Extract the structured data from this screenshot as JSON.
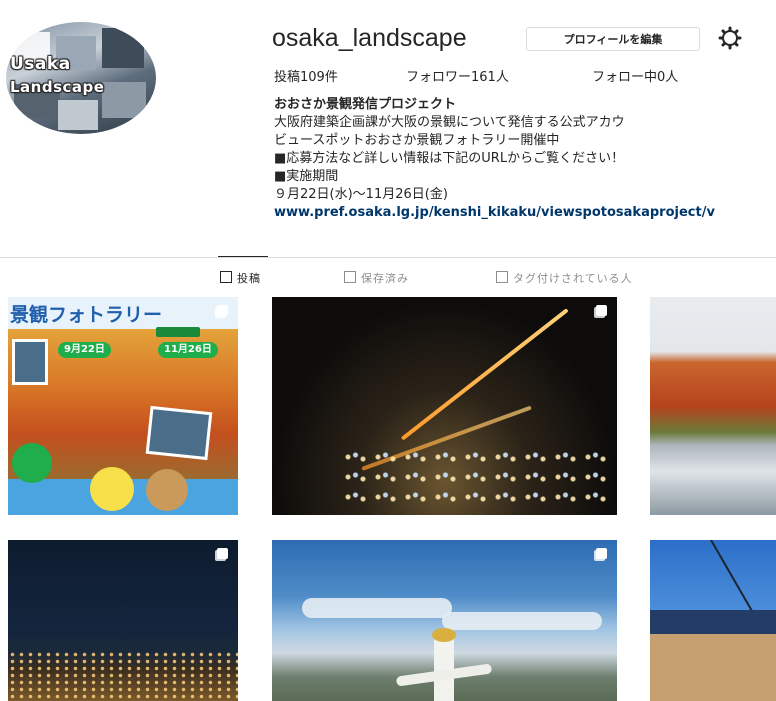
{
  "profile": {
    "avatar_text_line1": "Usaka",
    "avatar_text_line2": "Landscape",
    "username": "osaka_landscape",
    "edit_button": "プロフィールを編集",
    "settings_icon": "gear-icon"
  },
  "stats": {
    "posts": "投稿109件",
    "followers": "フォロワー161人",
    "following": "フォロー中0人"
  },
  "bio": {
    "name": "おおさか景観発信プロジェクト",
    "line1": "大阪府建築企画課が大阪の景観について発信する公式アカウ",
    "line2": "ビュースポットおおさか景観フォトラリー開催中",
    "line3": "■応募方法など詳しい情報は下記のURLからご覧ください！",
    "line4": "■実施期間",
    "line5": "９月22日(水)～11月26日(金)",
    "link": "www.pref.osaka.lg.jp/kenshi_kikaku/viewspotosakaproject/v"
  },
  "tabs": {
    "posts": "投稿",
    "saved": "保存済み",
    "tagged": "タグ付けされている人"
  },
  "posts": {
    "p1": {
      "title": "景観フォトラリー",
      "date_start": "9月22日",
      "date_end": "11月26日"
    }
  },
  "colors": {
    "link": "#00376b",
    "divider": "#dbdbdb",
    "poster_blue": "#1f5fae",
    "poster_green": "#1fae4b"
  }
}
